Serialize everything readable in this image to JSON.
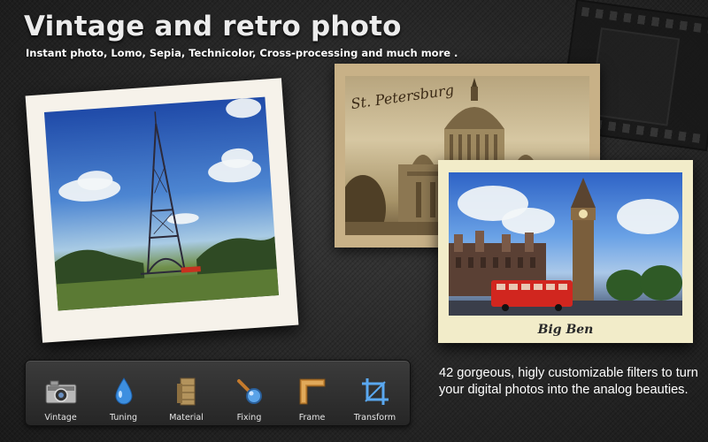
{
  "header": {
    "title": "Vintage and retro photo",
    "subtitle": "Instant photo, Lomo, Sepia, Technicolor, Cross-processing and much more ."
  },
  "photos": {
    "sepia_caption": "St. Petersburg",
    "bigben_caption": "Big Ben"
  },
  "toolbar": {
    "items": [
      {
        "label": "Vintage",
        "icon": "camera-icon"
      },
      {
        "label": "Tuning",
        "icon": "droplet-icon"
      },
      {
        "label": "Material",
        "icon": "paper-roll-icon"
      },
      {
        "label": "Fixing",
        "icon": "magnifier-icon"
      },
      {
        "label": "Frame",
        "icon": "frame-icon"
      },
      {
        "label": "Transform",
        "icon": "crop-icon"
      }
    ]
  },
  "tagline": "42 gorgeous, higly customizable filters to turn your digital photos into the analog beauties.",
  "colors": {
    "background": "#262626",
    "polaroid_border": "#f6f2ea",
    "sepia": "#c8b187",
    "accent_blue": "#4d86d2"
  }
}
